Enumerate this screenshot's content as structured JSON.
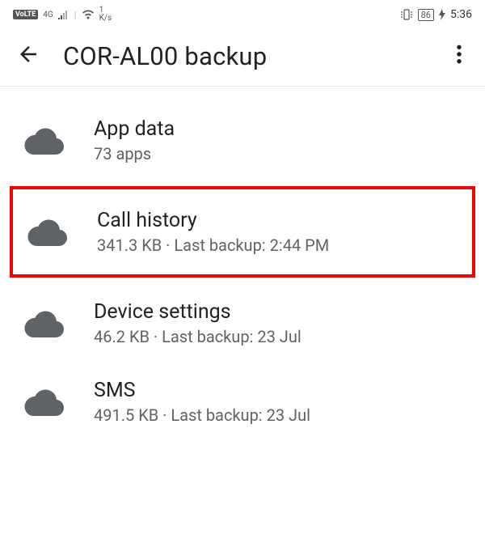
{
  "status": {
    "volte": "VoLTE",
    "network": "4G",
    "speed_value": "1",
    "speed_unit": "K/s",
    "battery": "86",
    "time": "5:36"
  },
  "appbar": {
    "title": "COR-AL00 backup"
  },
  "items": [
    {
      "title": "App data",
      "subtitle": "73 apps",
      "highlighted": false
    },
    {
      "title": "Call history",
      "subtitle": "341.3 KB · Last backup: 2:44 PM",
      "highlighted": true
    },
    {
      "title": "Device settings",
      "subtitle": "46.2 KB · Last backup: 23 Jul",
      "highlighted": false
    },
    {
      "title": "SMS",
      "subtitle": "491.5 KB · Last backup: 23 Jul",
      "highlighted": false
    }
  ]
}
